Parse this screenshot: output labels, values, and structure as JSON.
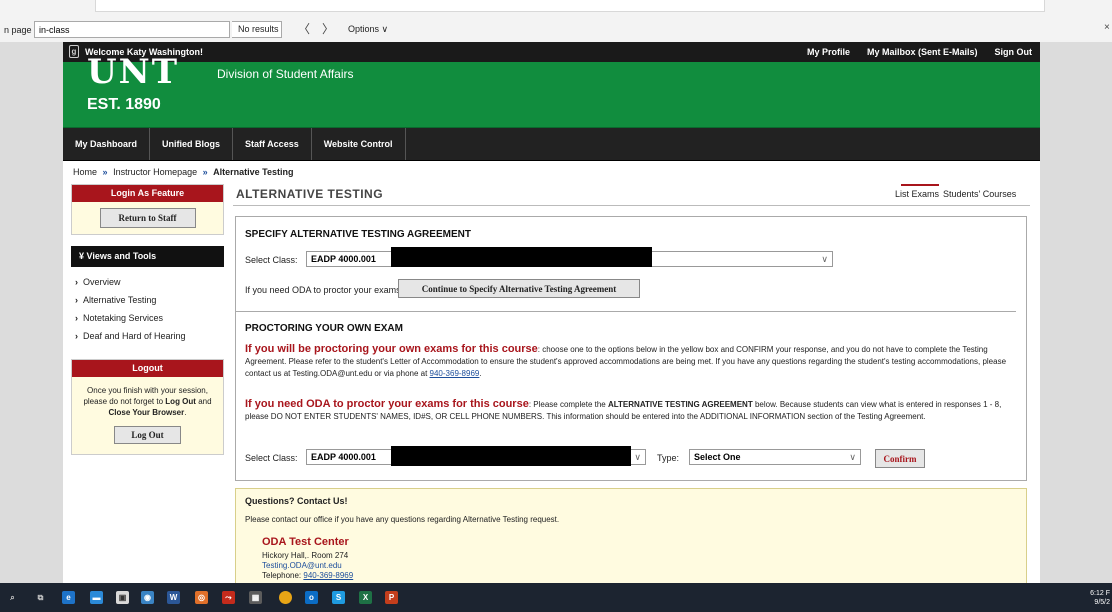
{
  "findbar": {
    "label": "n page",
    "query": "in-class",
    "results": "No results",
    "prev": "〈",
    "next": "〉",
    "options": "Options ∨",
    "close": "×"
  },
  "topbar": {
    "welcome": "Welcome Katy Washington!",
    "links": [
      "My Profile",
      "My Mailbox (Sent E-Mails)",
      "Sign Out"
    ]
  },
  "banner": {
    "logo": "UNT",
    "est": "EST. 1890",
    "division": "Division of Student Affairs"
  },
  "mainnav": [
    "My Dashboard",
    "Unified Blogs",
    "Staff Access",
    "Website Control"
  ],
  "breadcrumb": {
    "home": "Home",
    "instructor": "Instructor Homepage",
    "current": "Alternative Testing",
    "sep": "»"
  },
  "sidebar": {
    "login_feature": "Login As Feature",
    "return_button": "Return to Staff",
    "views_title": "¥ Views and Tools",
    "links": [
      "Overview",
      "Alternative Testing",
      "Notetaking Services",
      "Deaf and Hard of Hearing"
    ],
    "logout_title": "Logout",
    "logout_msg_1": "Once you finish with your session, please do not forget to",
    "logout_msg_bold1": "Log Out",
    "logout_msg_2": "and",
    "logout_msg_bold2": "Close Your Browser",
    "logout_msg_3": ".",
    "logout_button": "Log Out"
  },
  "main": {
    "title": "ALTERNATIVE TESTING",
    "tab_list": "List Exams",
    "tab_students": "Students' Courses",
    "section1": {
      "title": "SPECIFY ALTERNATIVE TESTING AGREEMENT",
      "select_label": "Select Class:",
      "class_value": "EADP 4000.001",
      "need_text": "If you need ODA to proctor your exams,",
      "continue_button": "Continue to Specify Alternative Testing Agreement"
    },
    "section2": {
      "title": "PROCTORING YOUR OWN EXAM",
      "p1_lead": "If you will be proctoring your own exams for this course",
      "p1_text": ": choose one to the options below in the yellow box and CONFIRM your response, and you do not have to complete the Testing Agreement. Please refer to the student's Letter of Accommodation to ensure the student's approved accommodations are being met. If you have any questions regarding the student's testing accommodations, please contact us at Testing.ODA@unt.edu or via phone at ",
      "p1_phone": "940-369-8969",
      "p1_end": ".",
      "p2_lead": "If you need ODA to proctor your exams for this course",
      "p2_text1": ": Please complete the ",
      "p2_bold": "ALTERNATIVE TESTING AGREEMENT",
      "p2_text2": " below. Because students can view what is entered in responses 1 - 8, please DO NOT ENTER STUDENTS' NAMES, ID#S, OR CELL PHONE NUMBERS. This information should be entered into the ADDITIONAL INFORMATION section of the Testing Agreement.",
      "select_label": "Select Class:",
      "class_value": "EADP 4000.001",
      "type_label": "Type:",
      "type_value": "Select One",
      "confirm_button": "Confirm"
    }
  },
  "contact": {
    "title": "Questions? Contact Us!",
    "line": "Please contact our office if you have any questions regarding Alternative Testing request.",
    "name": "ODA Test Center",
    "address": "Hickory Hall,. Room 274",
    "email": "Testing.ODA@unt.edu",
    "phone_label": "Telephone: ",
    "phone": "940-369-8969"
  },
  "taskbar": {
    "time": "6:12 F",
    "date": "9/5/2"
  }
}
